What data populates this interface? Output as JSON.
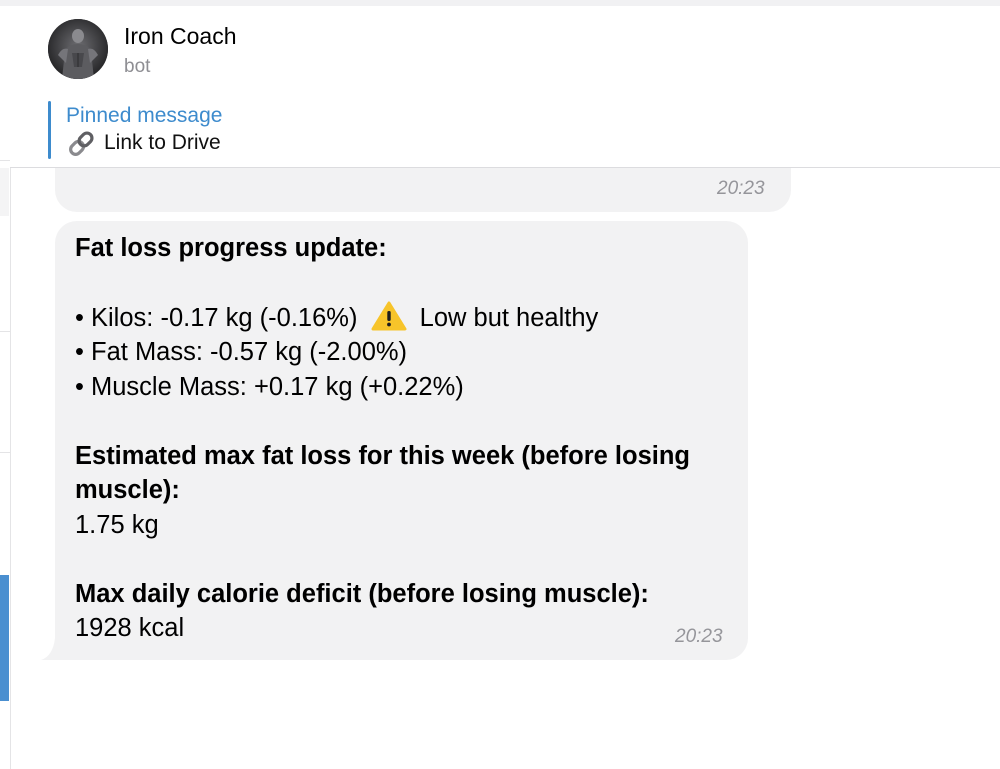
{
  "header": {
    "chat_name": "Iron Coach",
    "chat_status": "bot",
    "avatar_icon": "bodybuilder-avatar"
  },
  "pinned": {
    "title": "Pinned message",
    "icon": "link-icon",
    "text": "Link to Drive"
  },
  "previous_message": {
    "time": "20:23"
  },
  "message": {
    "heading": "Fat loss progress update:",
    "bullets": [
      {
        "text": "• Kilos: -0.17 kg (-0.16%)",
        "icon": "warning-icon",
        "note": "Low but healthy"
      },
      {
        "text": "• Fat Mass: -0.57 kg (-2.00%)"
      },
      {
        "text": "• Muscle Mass: +0.17 kg (+0.22%)"
      }
    ],
    "section1_title_line1": "Estimated max fat loss for this week (before losing",
    "section1_title_line2": "muscle):",
    "section1_value": "1.75 kg",
    "section2_title": "Max daily calorie deficit (before losing muscle):",
    "section2_value": "1928 kcal",
    "time": "20:23"
  },
  "colors": {
    "accent": "#3d8bcd",
    "bubble": "#f2f2f3",
    "time": "#95959a",
    "selection": "#4a8fd0"
  }
}
